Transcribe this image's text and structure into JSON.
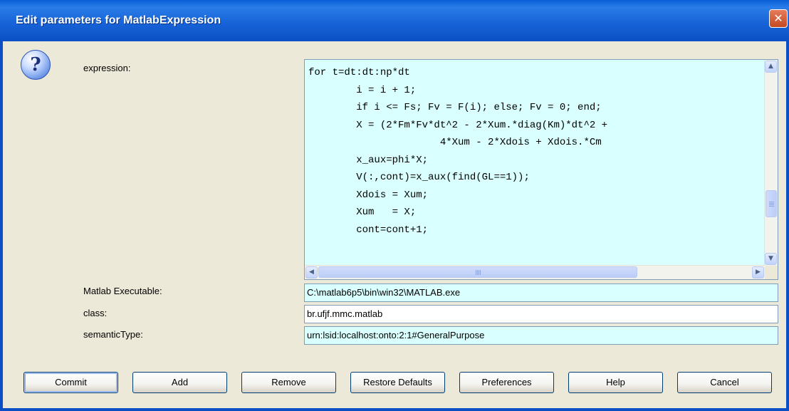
{
  "window": {
    "title": "Edit parameters for MatlabExpression",
    "close_glyph": "✕"
  },
  "icon": {
    "name": "question-icon",
    "glyph": "?"
  },
  "labels": {
    "expression": "expression:",
    "matlab_executable": "Matlab Executable:",
    "class": "class:",
    "semantic_type": "semanticType:"
  },
  "expression": {
    "lines": [
      "for t=dt:dt:np*dt",
      "        i = i + 1;",
      "        if i <= Fs; Fv = F(i); else; Fv = 0; end;",
      "        X = (2*Fm*Fv*dt^2 - 2*Xum.*diag(Km)*dt^2 +",
      "                      4*Xum - 2*Xdois + Xdois.*Cm",
      "        x_aux=phi*X;",
      "        V(:,cont)=x_aux(find(GL==1));",
      "        Xdois = Xum;",
      "        Xum   = X;",
      "        cont=cont+1;"
    ]
  },
  "fields": {
    "matlab_executable": "C:\\matlab6p5\\bin\\win32\\MATLAB.exe",
    "class": "br.ufjf.mmc.matlab",
    "semantic_type": "urn:lsid:localhost:onto:2:1#GeneralPurpose"
  },
  "buttons": {
    "commit": "Commit",
    "add": "Add",
    "remove": "Remove",
    "restore_defaults": "Restore Defaults",
    "preferences": "Preferences",
    "help": "Help",
    "cancel": "Cancel"
  },
  "scroll_glyphs": {
    "up": "▲",
    "down": "▼",
    "left": "◀",
    "right": "▶"
  },
  "colors": {
    "titlebar": "#1764d8",
    "field_highlight": "#d9ffff",
    "dialog_bg": "#ece9d8",
    "close_button": "#c44a21"
  }
}
